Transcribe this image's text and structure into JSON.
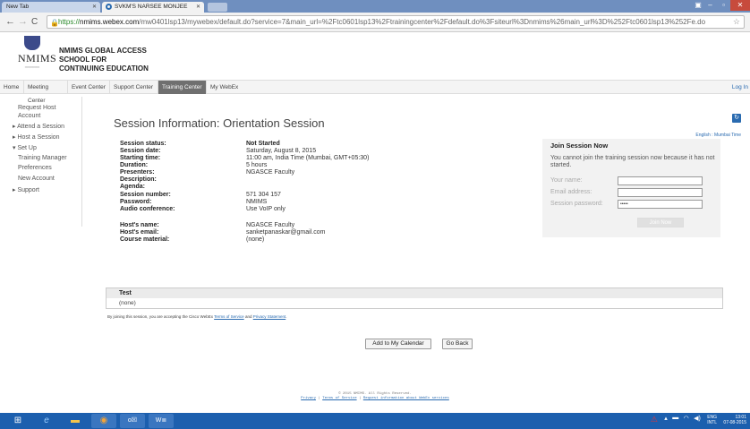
{
  "browser": {
    "tabs": [
      {
        "label": "New Tab"
      },
      {
        "label": "SVKM'S NARSEE MONJEE"
      }
    ],
    "url_scheme": "https://",
    "url_host": "nmims.webex.com",
    "url_path": "/mw0401lsp13/mywebex/default.do?service=7&main_url=%2Ftc0601lsp13%2Ftrainingcenter%2Fdefault.do%3Fsiteurl%3Dnmims%26main_url%3D%252Ftc0601lsp13%252Fe.do"
  },
  "header": {
    "logo_text": "NMIMS",
    "org_line1": "NMIMS GLOBAL ACCESS",
    "org_line2": "SCHOOL FOR",
    "org_line3": "CONTINUING EDUCATION"
  },
  "nav": {
    "items": [
      "Home",
      "Meeting Center",
      "Event Center",
      "Support Center",
      "Training Center",
      "My WebEx"
    ],
    "login": "Log In"
  },
  "sidebar": {
    "items": [
      "Request Host",
      "Account",
      "▸ Attend a Session",
      "▸ Host a Session",
      "▾ Set Up",
      "Training Manager",
      "Preferences",
      "New Account",
      "▸ Support"
    ]
  },
  "main": {
    "title": "Session Information: Orientation Session",
    "lang_link": "English : Mumbai Time",
    "fields": [
      {
        "label": "Session status:",
        "value": "Not Started"
      },
      {
        "label": "Session date:",
        "value": "Saturday, August 8, 2015"
      },
      {
        "label": "Starting time:",
        "value": "11:00 am, India Time (Mumbai, GMT+05:30)"
      },
      {
        "label": "Duration:",
        "value": "5 hours"
      },
      {
        "label": "Presenters:",
        "value": "NGASCE Faculty"
      },
      {
        "label": "Description:",
        "value": ""
      },
      {
        "label": "Agenda:",
        "value": ""
      },
      {
        "label": "Session number:",
        "value": "571 304 157"
      },
      {
        "label": "Password:",
        "value": "NMIMS"
      },
      {
        "label": "Audio conference:",
        "value": "Use VoIP only"
      },
      {
        "label": "Host's name:",
        "value": "NGASCE Faculty"
      },
      {
        "label": "Host's email:",
        "value": "sanketpanaskar@gmail.com"
      },
      {
        "label": "Course material:",
        "value": "(none)"
      }
    ],
    "test_header": "Test",
    "test_value": "(none)",
    "agreement_prefix": "By joining this session, you are accepting the Cisco WebEx",
    "terms_link": "Terms of Service",
    "and_text": "and",
    "privacy_link": "Privacy Statement",
    "add_calendar": "Add to My Calendar",
    "go_back": "Go Back"
  },
  "join": {
    "heading": "Join Session Now",
    "message": "You cannot join the training session now because it has not started.",
    "name_label": "Your name:",
    "email_label": "Email address:",
    "password_label": "Session password:",
    "password_value": "•••••",
    "button": "Join Now"
  },
  "footer": {
    "copyright": "© 2015 NMIMS. All Rights Reserved.",
    "privacy": "Privacy",
    "terms": "Terms of Service",
    "request": "Request information about WebEx services"
  },
  "taskbar": {
    "lang": "ENG",
    "region": "INTL",
    "time": "13:01",
    "date": "07-08-2015"
  }
}
